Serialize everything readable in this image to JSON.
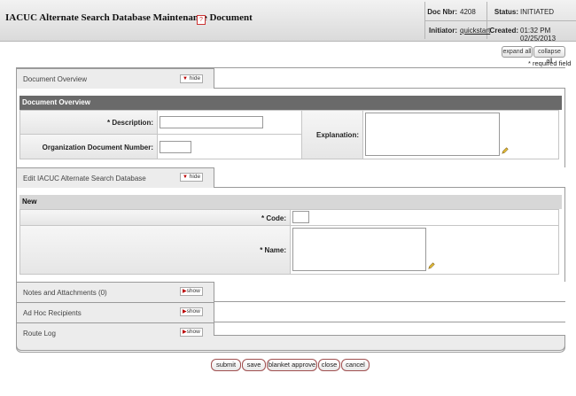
{
  "header": {
    "title": "IACUC Alternate Search Database Maintenance Document",
    "help_glyph": "?",
    "doc_nbr_label": "Doc Nbr:",
    "doc_nbr": "4208",
    "status_label": "Status:",
    "status": "INITIATED",
    "initiator_label": "Initiator:",
    "initiator": "quickstart",
    "created_label": "Created:",
    "created": "01:32 PM 02/25/2013"
  },
  "toolbar": {
    "expand_all": "expand all",
    "collapse_all": "collapse all",
    "required_note": "* required field"
  },
  "panels": {
    "document_overview": {
      "tab_label": "Document Overview",
      "toggle": "hide",
      "section_title": "Document Overview",
      "description_label": "* Description:",
      "description_value": "",
      "org_doc_number_label": "Organization Document Number:",
      "org_doc_number_value": "",
      "explanation_label": "Explanation:",
      "explanation_value": ""
    },
    "edit_database": {
      "tab_label": "Edit IACUC Alternate Search Database",
      "toggle": "hide",
      "section_title": "New",
      "code_label": "* Code:",
      "code_value": "",
      "name_label": "* Name:",
      "name_value": ""
    },
    "notes": {
      "tab_label": "Notes and Attachments (0)",
      "toggle": "show"
    },
    "adhoc": {
      "tab_label": "Ad Hoc Recipients",
      "toggle": "show"
    },
    "route_log": {
      "tab_label": "Route Log",
      "toggle": "show"
    }
  },
  "actions": {
    "submit": "submit",
    "save": "save",
    "blanket_approve": "blanket approve",
    "close": "close",
    "cancel": "cancel"
  }
}
